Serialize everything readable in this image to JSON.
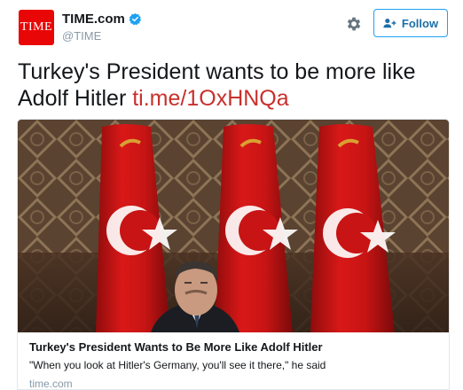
{
  "account": {
    "avatar_text": "TIME",
    "display_name": "TIME.com",
    "handle": "@TIME",
    "verified": true,
    "brand_color": "#e90606"
  },
  "actions": {
    "settings_icon": "gear-icon",
    "follow_label": "Follow",
    "follow_icon": "add-user-icon",
    "accent_color": "#1da1f2"
  },
  "tweet": {
    "text": "Turkey's President wants to be more like Adolf Hitler ",
    "link": "ti.me/1OxHNQa",
    "link_color": "#c9302c"
  },
  "card": {
    "image_alt": "Man in front of Turkish flags",
    "title": "Turkey's President Wants to Be More Like Adolf Hitler",
    "description": "\"When you look at Hitler's Germany, you'll see it there,\" he said",
    "domain": "time.com"
  }
}
